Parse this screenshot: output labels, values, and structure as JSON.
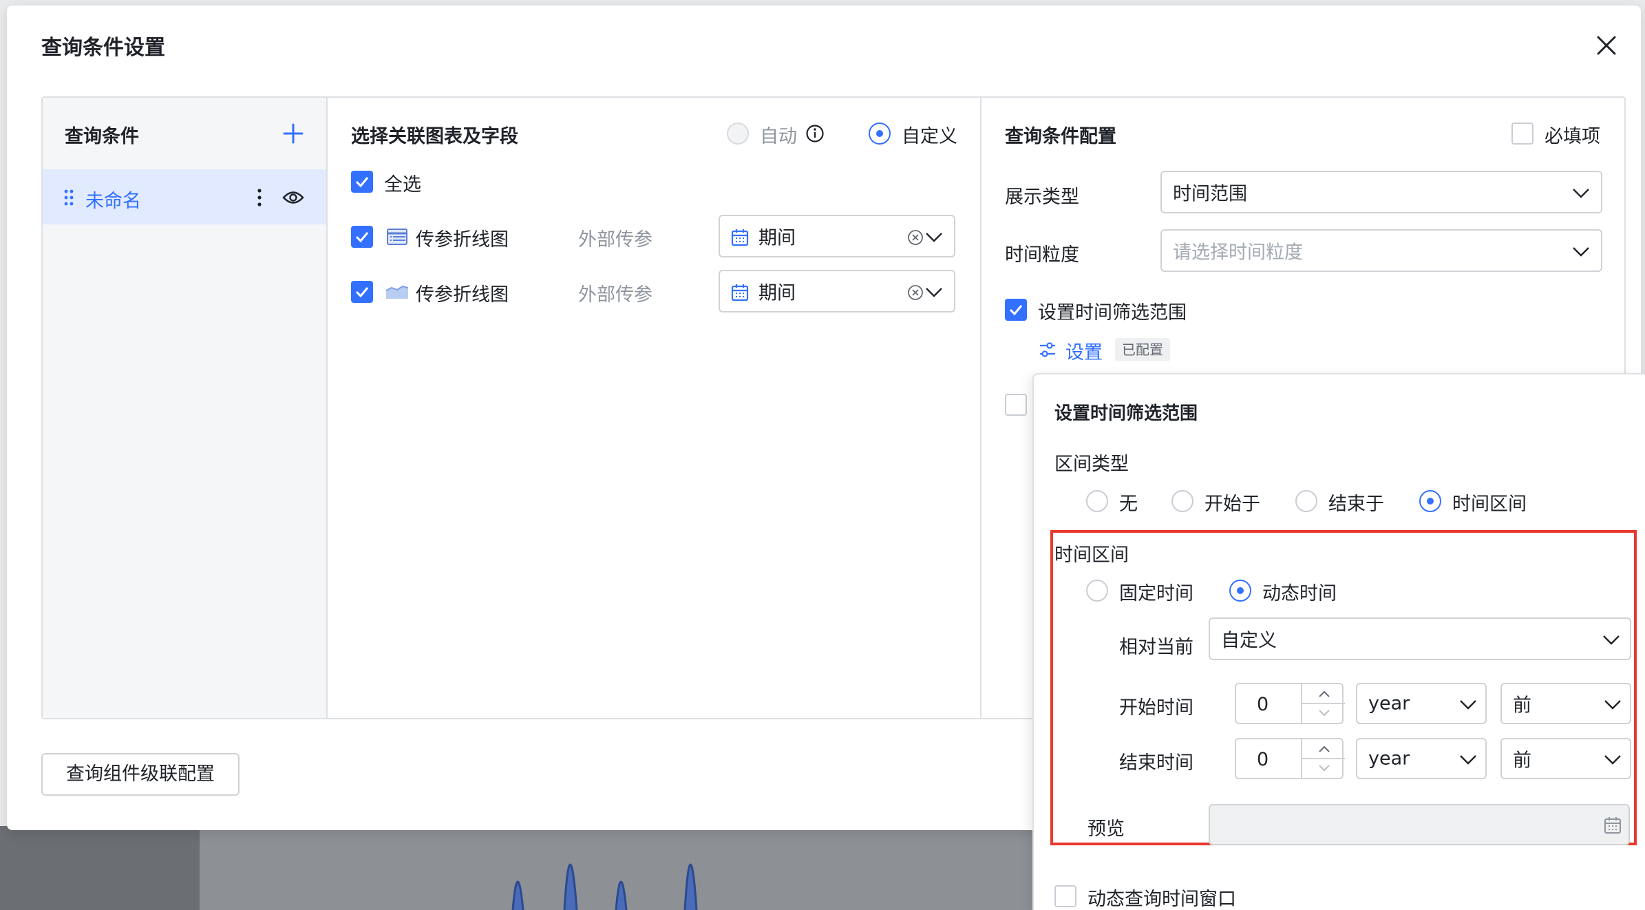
{
  "modal": {
    "title": "查询条件设置",
    "footer_button": "查询组件级联配置"
  },
  "left_panel": {
    "title": "查询条件",
    "items": [
      {
        "label": "未命名"
      }
    ]
  },
  "middle_panel": {
    "title": "选择关联图表及字段",
    "mode_options": [
      {
        "label": "自动",
        "selected": false,
        "disabled": true
      },
      {
        "label": "自定义",
        "selected": true
      }
    ],
    "select_all": {
      "label": "全选",
      "checked": true
    },
    "rows": [
      {
        "checked": true,
        "chart_icon": "table-chart-icon",
        "chart_name": "传参折线图",
        "source": "外部传参",
        "field": "期间"
      },
      {
        "checked": true,
        "chart_icon": "area-chart-icon",
        "chart_name": "传参折线图",
        "source": "外部传参",
        "field": "期间"
      }
    ]
  },
  "right_panel": {
    "title": "查询条件配置",
    "required": {
      "label": "必填项",
      "checked": false
    },
    "display_type": {
      "label": "展示类型",
      "value": "时间范围"
    },
    "time_granularity": {
      "label": "时间粒度",
      "placeholder": "请选择时间粒度"
    },
    "time_filter": {
      "label": "设置时间筛选范围",
      "checked": true,
      "link": "设置",
      "tag": "已配置"
    },
    "second_checkbox_checked": false
  },
  "popover": {
    "title": "设置时间筛选范围",
    "interval_type_label": "区间类型",
    "interval_types": [
      {
        "label": "无",
        "selected": false
      },
      {
        "label": "开始于",
        "selected": false
      },
      {
        "label": "结束于",
        "selected": false
      },
      {
        "label": "时间区间",
        "selected": true
      }
    ],
    "interval_section_label": "时间区间",
    "time_modes": [
      {
        "label": "固定时间",
        "selected": false
      },
      {
        "label": "动态时间",
        "selected": true
      }
    ],
    "relative_label": "相对当前",
    "relative_value": "自定义",
    "start": {
      "label": "开始时间",
      "value": "0",
      "unit": "year",
      "direction": "前"
    },
    "end": {
      "label": "结束时间",
      "value": "0",
      "unit": "year",
      "direction": "前"
    },
    "preview_label": "预览",
    "dynamic_window": {
      "label": "动态查询时间窗口",
      "checked": false
    }
  },
  "colors": {
    "accent": "#3370ff",
    "highlight_border": "#e9382f",
    "selected_item_bg": "#e1eaff"
  }
}
